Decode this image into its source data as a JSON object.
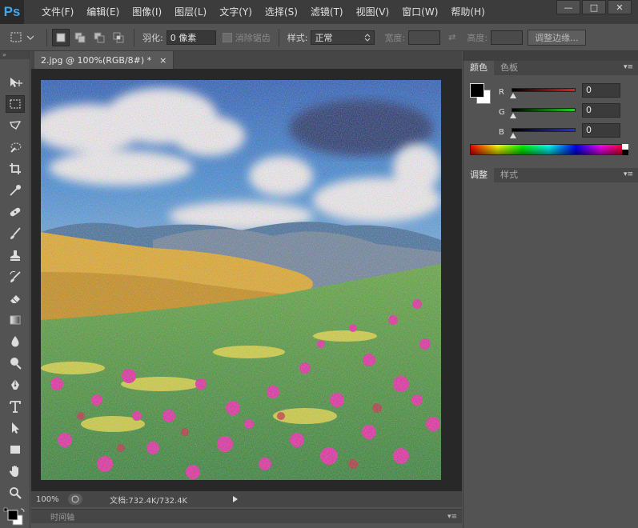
{
  "app": {
    "logo": "Ps",
    "accent": "#3fa7ec"
  },
  "menu": [
    {
      "label": "文件(F)"
    },
    {
      "label": "编辑(E)"
    },
    {
      "label": "图像(I)"
    },
    {
      "label": "图层(L)"
    },
    {
      "label": "文字(Y)"
    },
    {
      "label": "选择(S)"
    },
    {
      "label": "滤镜(T)"
    },
    {
      "label": "视图(V)"
    },
    {
      "label": "窗口(W)"
    },
    {
      "label": "帮助(H)"
    }
  ],
  "window_controls": {
    "minimize": "—",
    "maximize": "□",
    "close": "✕"
  },
  "options_bar": {
    "feather_label": "羽化:",
    "feather_value": "0 像素",
    "antialias_label": "消除锯齿",
    "style_label": "样式:",
    "style_value": "正常",
    "width_label": "宽度:",
    "height_label": "高度:",
    "refine_edge": "调整边缘..."
  },
  "document": {
    "tab_title": "2.jpg @ 100%(RGB/8#) *",
    "tab_close": "×",
    "zoom": "100%",
    "doc_info": "文档:732.4K/732.4K"
  },
  "timeline": {
    "label": "时间轴"
  },
  "panels": {
    "color_tabs": [
      {
        "label": "颜色"
      },
      {
        "label": "色板"
      }
    ],
    "adjust_tabs": [
      {
        "label": "调整"
      },
      {
        "label": "样式"
      }
    ],
    "sliders": [
      {
        "label": "R",
        "value": "0",
        "color": "#e32020"
      },
      {
        "label": "G",
        "value": "0",
        "color": "#20d420"
      },
      {
        "label": "B",
        "value": "0",
        "color": "#2030e8"
      }
    ],
    "foreground": "#000000",
    "background": "#ffffff"
  },
  "toolbox": {
    "tools": [
      {
        "name": "move-tool-icon"
      },
      {
        "name": "marquee-tool-icon"
      },
      {
        "name": "lasso-tool-icon"
      },
      {
        "name": "quick-select-tool-icon"
      },
      {
        "name": "crop-tool-icon"
      },
      {
        "name": "eyedropper-tool-icon"
      },
      {
        "name": "healing-brush-tool-icon"
      },
      {
        "name": "brush-tool-icon"
      },
      {
        "name": "clone-stamp-tool-icon"
      },
      {
        "name": "history-brush-tool-icon"
      },
      {
        "name": "eraser-tool-icon"
      },
      {
        "name": "gradient-tool-icon"
      },
      {
        "name": "blur-tool-icon"
      },
      {
        "name": "dodge-tool-icon"
      },
      {
        "name": "pen-tool-icon"
      },
      {
        "name": "type-tool-icon"
      },
      {
        "name": "path-select-tool-icon"
      },
      {
        "name": "rectangle-tool-icon"
      },
      {
        "name": "hand-tool-icon"
      },
      {
        "name": "zoom-tool-icon"
      }
    ]
  }
}
